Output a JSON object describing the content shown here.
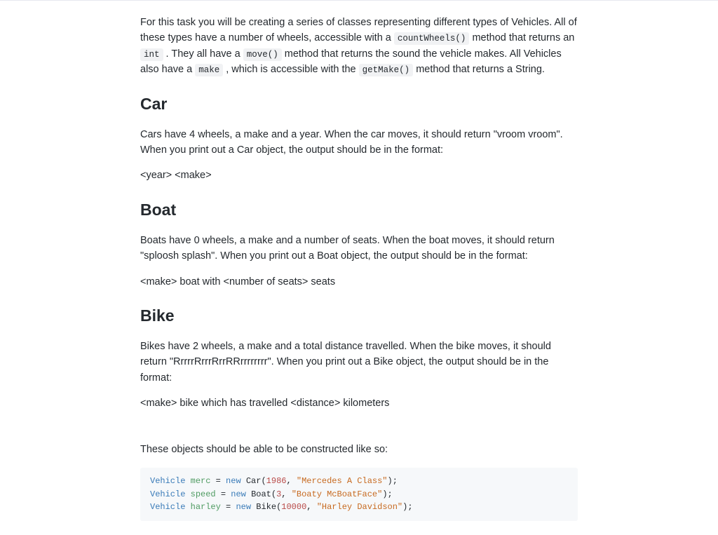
{
  "intro": {
    "p1a": "For this task you will be creating a series of classes representing different types of Vehicles. All of these types have a number of wheels, accessible with a ",
    "code1": "countWheels()",
    "p1b": " method that returns an ",
    "code2": "int",
    "p1c": " . They all have a ",
    "code3": "move()",
    "p1d": " method that returns the sound the vehicle makes. All Vehicles also have a ",
    "code4": "make",
    "p1e": " , which is accessible with the ",
    "code5": "getMake()",
    "p1f": " method that returns a String."
  },
  "car": {
    "heading": "Car",
    "desc": "Cars have 4 wheels, a make and a year. When the car moves, it should return \"vroom vroom\". When you print out a Car object, the output should be in the format:",
    "format": "<year> <make>"
  },
  "boat": {
    "heading": "Boat",
    "desc": "Boats have 0 wheels, a make and a number of seats. When the boat moves, it should return \"sploosh splash\". When you print out a Boat object, the output should be in the format:",
    "format": "<make> boat with <number of seats> seats"
  },
  "bike": {
    "heading": "Bike",
    "desc": "Bikes have 2 wheels, a make and a total distance travelled. When the bike moves, it should return \"RrrrrRrrrRrrRRrrrrrrrr\". When you print out a Bike object, the output should be in the format:",
    "format": "<make> bike which has travelled <distance> kilometers"
  },
  "construct_note": "These objects should be able to be constructed like so:",
  "code": {
    "l1": {
      "type": "Vehicle",
      "var": "merc",
      "kw": "new",
      "cls": "Car",
      "num": "1986",
      "str": "\"Mercedes A Class\""
    },
    "l2": {
      "type": "Vehicle",
      "var": "speed",
      "kw": "new",
      "cls": "Boat",
      "num": "3",
      "str": "\"Boaty McBoatFace\""
    },
    "l3": {
      "type": "Vehicle",
      "var": "harley",
      "kw": "new",
      "cls": "Bike",
      "num": "10000",
      "str": "\"Harley Davidson\""
    }
  }
}
